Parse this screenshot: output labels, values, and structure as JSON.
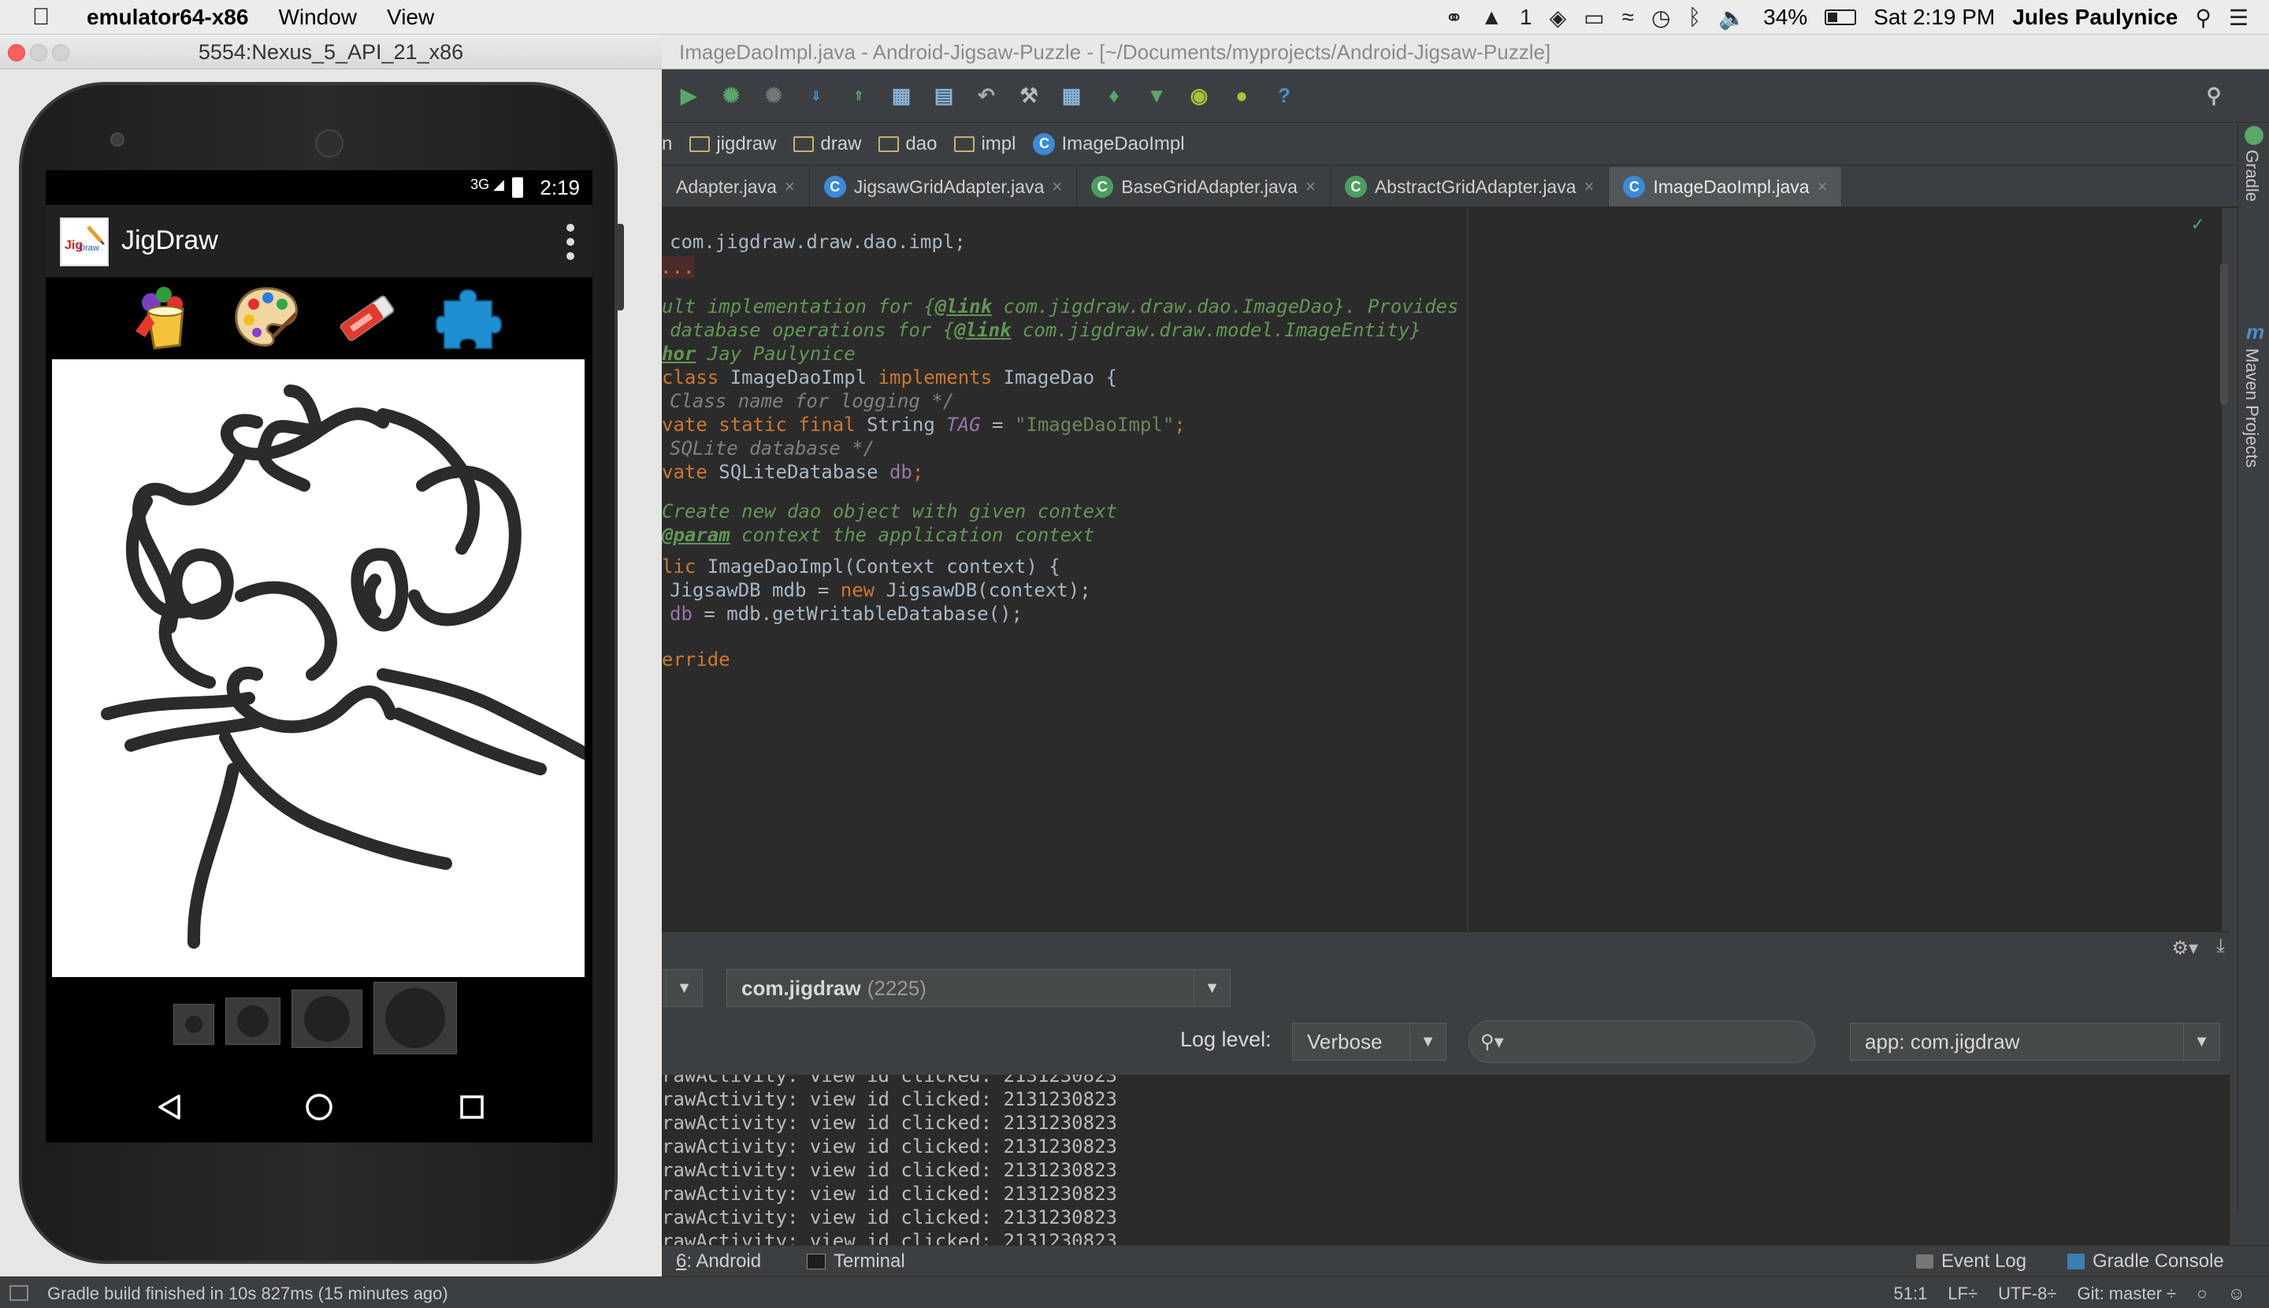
{
  "menubar": {
    "app_name": "emulator64-x86",
    "menus": [
      "Window",
      "View"
    ],
    "status_items": {
      "input_indicator": "1",
      "battery_percent": "34%",
      "clock": "Sat 2:19 PM",
      "user": "Jules Paulynice"
    }
  },
  "emulator": {
    "window_title": "5554:Nexus_5_API_21_x86",
    "status_bar": {
      "network": "3G",
      "time": "2:19"
    },
    "app": {
      "title": "JigDraw",
      "logo_icon": "jigdraw-logo-icon"
    },
    "tools": [
      "paint-bucket-icon",
      "palette-icon",
      "eraser-icon",
      "puzzle-piece-icon"
    ],
    "brush_sizes": [
      "small",
      "medium",
      "large",
      "extra-large"
    ],
    "nav_buttons": [
      "back-icon",
      "home-icon",
      "recents-icon"
    ]
  },
  "ide": {
    "title": "ImageDaoImpl.java - Android-Jigsaw-Puzzle - [~/Documents/myprojects/Android-Jigsaw-Puzzle]",
    "breadcrumbs": [
      "n",
      "jigdraw",
      "draw",
      "dao",
      "impl",
      "ImageDaoImpl"
    ],
    "tabs": [
      {
        "label": "Adapter.java",
        "active": false
      },
      {
        "label": "JigsawGridAdapter.java",
        "active": false
      },
      {
        "label": "BaseGridAdapter.java",
        "active": false
      },
      {
        "label": "AbstractGridAdapter.java",
        "active": false
      },
      {
        "label": "ImageDaoImpl.java",
        "active": true
      }
    ],
    "tool_windows_right": [
      "Gradle",
      "Maven Projects"
    ],
    "logcat": {
      "process": "com.jigdraw",
      "pid": "(2225)",
      "log_level_label": "Log level:",
      "log_level": "Verbose",
      "search_placeholder": "",
      "filter": "app: com.jigdraw",
      "lines": [
        "rawActivity: view id clicked: 2131230823",
        "rawActivity: view id clicked: 2131230823",
        "rawActivity: view id clicked: 2131230823",
        "rawActivity: view id clicked: 2131230823",
        "rawActivity: view id clicked: 2131230823",
        "rawActivity: view id clicked: 2131230823",
        "rawActivity: view id clicked: 2131230823",
        "rawActivity: view id clicked: 2131230823"
      ]
    },
    "bottom_tabs": {
      "android_num": "6",
      "android": ": Android",
      "terminal": "Terminal",
      "event_log": "Event Log",
      "gradle_console": "Gradle Console"
    },
    "status": {
      "message": "Gradle build finished in 10s 827ms (15 minutes ago)",
      "position": "51:1",
      "line_sep": "LF÷",
      "encoding": "UTF-8÷",
      "git": "Git: master ÷"
    }
  },
  "code": {
    "l1": "com.jigdraw.draw.dao.impl;",
    "l2": "...",
    "l3a": "ult implementation for {",
    "l3b": "@link",
    "l3c": " com.jigdraw.draw.dao.ImageDao}. Provides",
    "l4a": "database operations for {",
    "l4b": "@link",
    "l4c": " com.jigdraw.draw.model.ImageEntity}",
    "l5a": "hor",
    "l5b": " Jay Paulynice",
    "l6a": "class",
    "l6b": " ImageDaoImpl ",
    "l6c": "implements",
    "l6d": " ImageDao {",
    "l7": "Class name for logging */",
    "l8a": "vate static final",
    "l8b": " String ",
    "l8c": "TAG",
    "l8d": " = ",
    "l8e": "\"ImageDaoImpl\"",
    "l8f": ";",
    "l9": "SQLite database */",
    "l10a": "vate",
    "l10b": " SQLiteDatabase ",
    "l10c": "db",
    "l10d": ";",
    "l11": "Create new dao object with given context",
    "l12a": "@param",
    "l12b": " context the application context",
    "l13a": "lic",
    "l13b": " ImageDaoImpl(Context context) {",
    "l14a": "JigsawDB mdb = ",
    "l14b": "new",
    "l14c": " JigsawDB(context);",
    "l15a": "db",
    "l15b": " = mdb.getWritableDatabase();",
    "l16": "erride"
  }
}
